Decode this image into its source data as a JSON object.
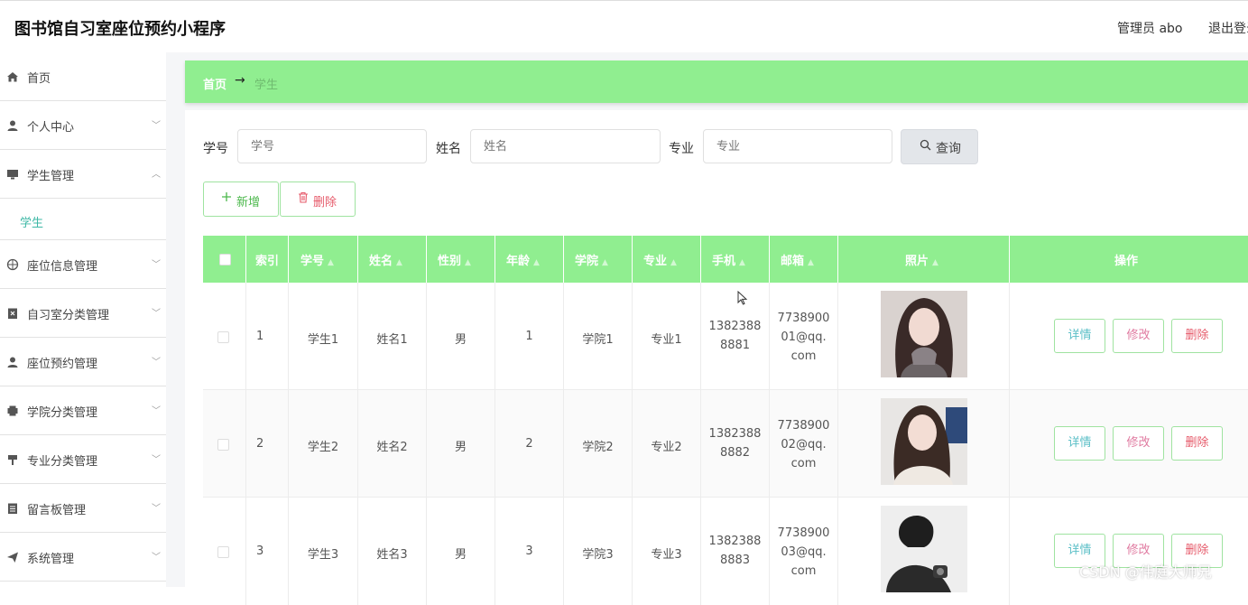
{
  "header": {
    "app_title": "图书馆自习室座位预约小程序",
    "admin_label": "管理员 abo",
    "logout": "退出登录"
  },
  "sidebar": {
    "items": [
      {
        "label": "首页",
        "icon": "home-icon"
      },
      {
        "label": "个人中心",
        "icon": "user-icon"
      },
      {
        "label": "学生管理",
        "icon": "monitor-icon",
        "expanded": true
      },
      {
        "label": "座位信息管理",
        "icon": "compass-icon"
      },
      {
        "label": "自习室分类管理",
        "icon": "clipboard-icon"
      },
      {
        "label": "座位预约管理",
        "icon": "user-icon"
      },
      {
        "label": "学院分类管理",
        "icon": "printer-icon"
      },
      {
        "label": "专业分类管理",
        "icon": "pin-icon"
      },
      {
        "label": "留言板管理",
        "icon": "list-icon"
      },
      {
        "label": "系统管理",
        "icon": "send-icon"
      }
    ],
    "sub_item": "学生"
  },
  "breadcrumb": {
    "home": "首页",
    "arrow": "→",
    "current": "学生"
  },
  "search": {
    "fields": [
      {
        "label": "学号",
        "placeholder": "学号"
      },
      {
        "label": "姓名",
        "placeholder": "姓名"
      },
      {
        "label": "专业",
        "placeholder": "专业"
      }
    ],
    "query_label": "查询"
  },
  "actions": {
    "add_label": "新增",
    "delete_label": "删除"
  },
  "table": {
    "headers": [
      "索引",
      "学号",
      "姓名",
      "性别",
      "年龄",
      "学院",
      "专业",
      "手机",
      "邮箱",
      "照片",
      "操作"
    ],
    "rows": [
      {
        "index": "1",
        "student_no": "学生1",
        "name": "姓名1",
        "gender": "男",
        "age": "1",
        "college": "学院1",
        "major": "专业1",
        "phone": [
          "1382388",
          "8881"
        ],
        "email": [
          "7738900",
          "01@qq.",
          "com"
        ]
      },
      {
        "index": "2",
        "student_no": "学生2",
        "name": "姓名2",
        "gender": "男",
        "age": "2",
        "college": "学院2",
        "major": "专业2",
        "phone": [
          "1382388",
          "8882"
        ],
        "email": [
          "7738900",
          "02@qq.",
          "com"
        ]
      },
      {
        "index": "3",
        "student_no": "学生3",
        "name": "姓名3",
        "gender": "男",
        "age": "3",
        "college": "学院3",
        "major": "专业3",
        "phone": [
          "1382388",
          "8883"
        ],
        "email": [
          "7738900",
          "03@qq.",
          "com"
        ]
      }
    ],
    "row_actions": {
      "detail": "详情",
      "edit": "修改",
      "delete": "删除"
    }
  },
  "watermark": "CSDN @伟庭大师兄",
  "colors": {
    "accent_green": "#90ee90",
    "active_teal": "#3eb8a6",
    "delete_red": "#e65a6a"
  }
}
